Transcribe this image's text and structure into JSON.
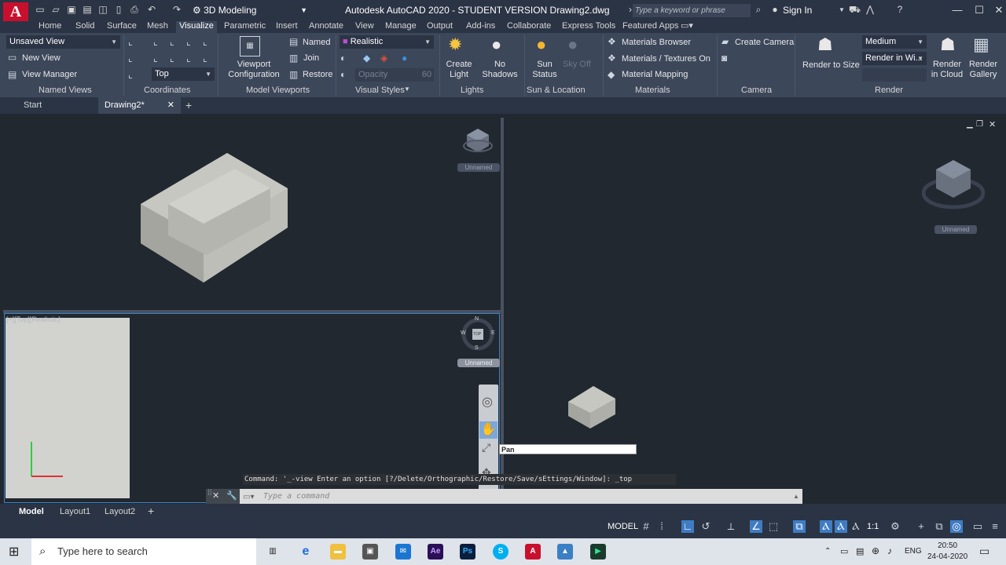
{
  "titlebar": {
    "logo": "A",
    "workspace": "3D Modeling",
    "title": "Autodesk AutoCAD 2020 - STUDENT VERSION    Drawing2.dwg",
    "search_placeholder": "Type a keyword or phrase",
    "signin": "Sign In"
  },
  "ribbon_tabs": [
    "Home",
    "Solid",
    "Surface",
    "Mesh",
    "Visualize",
    "Parametric",
    "Insert",
    "Annotate",
    "View",
    "Manage",
    "Output",
    "Add-ins",
    "Collaborate",
    "Express Tools",
    "Featured Apps"
  ],
  "ribbon": {
    "named_views": {
      "dropdown": "Unsaved View",
      "new_view": "New View",
      "view_manager": "View Manager",
      "title": "Named Views"
    },
    "coordinates": {
      "dropdown": "Top",
      "title": "Coordinates"
    },
    "model_viewports": {
      "config": "Viewport Configuration",
      "named": "Named",
      "join": "Join",
      "restore": "Restore",
      "title": "Model Viewports"
    },
    "visual_styles": {
      "dropdown": "Realistic",
      "opacity": "Opacity",
      "opacity_value": "60",
      "title": "Visual Styles"
    },
    "lights": {
      "create": "Create Light",
      "no_shadows": "No Shadows",
      "title": "Lights"
    },
    "sun": {
      "status": "Sun Status",
      "sky": "Sky Off",
      "title": "Sun & Location"
    },
    "materials": {
      "browser": "Materials Browser",
      "textures": "Materials / Textures On",
      "mapping": "Material Mapping",
      "title": "Materials"
    },
    "camera": {
      "create": "Create Camera",
      "title": "Camera"
    },
    "render": {
      "size": "Render to Size",
      "quality": "Medium",
      "target": "Render in Wi...",
      "cloud": "Render in Cloud",
      "gallery": "Render Gallery",
      "title": "Render"
    }
  },
  "doc_tabs": {
    "start": "Start",
    "drawing": "Drawing2*"
  },
  "viewports": {
    "label": "[+][Top][Realistic]",
    "unnamed": "Unnamed",
    "compass": {
      "n": "N",
      "s": "S",
      "e": "E",
      "w": "W",
      "face": "TOP"
    }
  },
  "tooltip": "Pan",
  "command": {
    "history": "Command: '_-view Enter an option [?/Delete/Orthographic/Restore/Save/sEttings/Window]: _top",
    "placeholder": "Type a command"
  },
  "layout_tabs": [
    "Model",
    "Layout1",
    "Layout2"
  ],
  "status": {
    "model": "MODEL",
    "scale": "1:1"
  },
  "taskbar": {
    "search": "Type here to search",
    "lang": "ENG",
    "time": "20:50",
    "date": "24-04-2020"
  },
  "colors": {
    "accent": "#3a84c8",
    "autocad_red": "#c8102e",
    "ribbon_bg": "#3c475a"
  }
}
